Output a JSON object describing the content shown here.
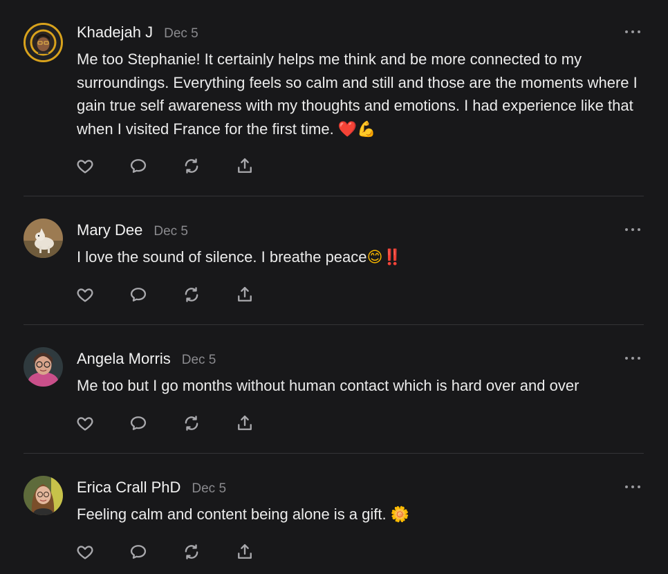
{
  "comments": [
    {
      "author": "Khadejah J",
      "date": "Dec 5",
      "text": "Me too Stephanie! It certainly helps me think and be more connected to my surroundings. Everything feels so calm and still and those are the moments where I gain true self awareness with my thoughts and emotions. I had experience like that when I visited France for the first time. ",
      "emoji": [
        "❤️",
        "💪"
      ]
    },
    {
      "author": "Mary Dee",
      "date": "Dec 5",
      "text": "I love the sound of silence. I breathe peace",
      "emoji": [
        "😊",
        "‼️"
      ]
    },
    {
      "author": "Angela Morris",
      "date": "Dec 5",
      "text": "Me too but I go months without human contact which is hard over and over",
      "emoji": []
    },
    {
      "author": "Erica Crall PhD",
      "date": "Dec 5",
      "text": "Feeling calm and content being alone is a gift. ",
      "emoji": [
        "🌼"
      ]
    }
  ],
  "icons": {
    "like": "heart-icon",
    "reply": "comment-bubble-icon",
    "restack": "restack-icon",
    "share": "share-icon",
    "more": "more-options-icon"
  },
  "colors": {
    "background": "#18181a",
    "text": "#ececec",
    "muted": "#8a8a8e",
    "icon": "#a9a9ad",
    "divider": "#343437"
  }
}
